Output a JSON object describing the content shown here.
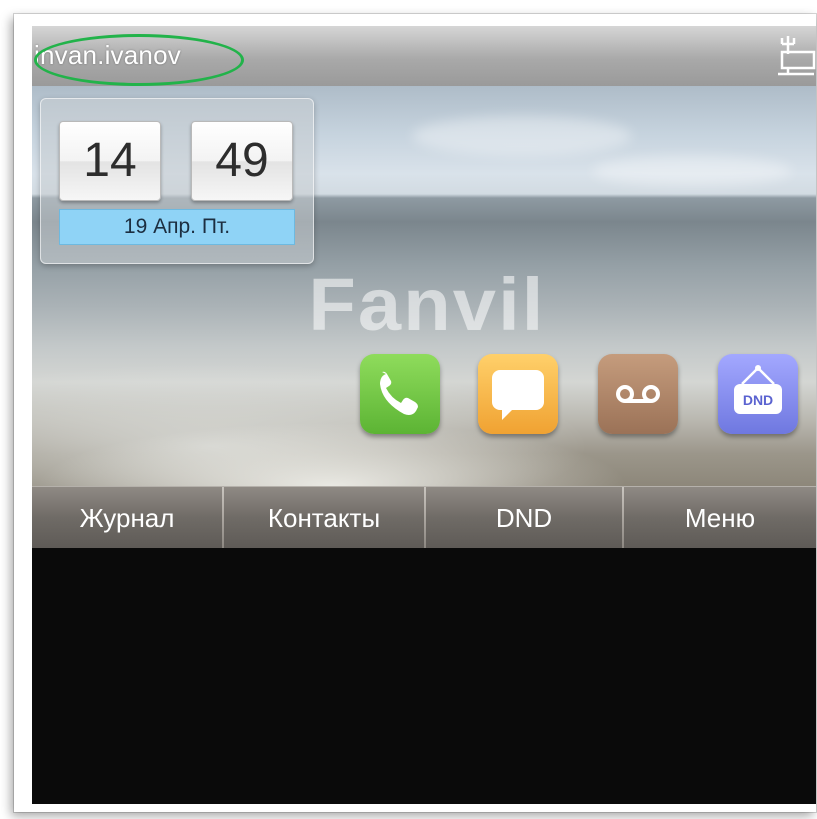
{
  "status_bar": {
    "account": "invan.ivanov",
    "network_icon": "ethernet-network-icon",
    "highlight_color": "#22b34a"
  },
  "clock": {
    "hours": "14",
    "minutes": "49",
    "date": "19 Апр. Пт."
  },
  "wallpaper": {
    "brand": "Fanvil"
  },
  "apps": [
    {
      "name": "phone-icon",
      "color": "#5cb434"
    },
    {
      "name": "message-icon",
      "color": "#f0a232"
    },
    {
      "name": "voicemail-icon",
      "color": "#9b7257"
    },
    {
      "name": "dnd-icon",
      "color": "#6f78e0",
      "label": "DND"
    }
  ],
  "softkeys": [
    {
      "label": "Журнал"
    },
    {
      "label": "Контакты"
    },
    {
      "label": "DND"
    },
    {
      "label": "Меню"
    }
  ]
}
